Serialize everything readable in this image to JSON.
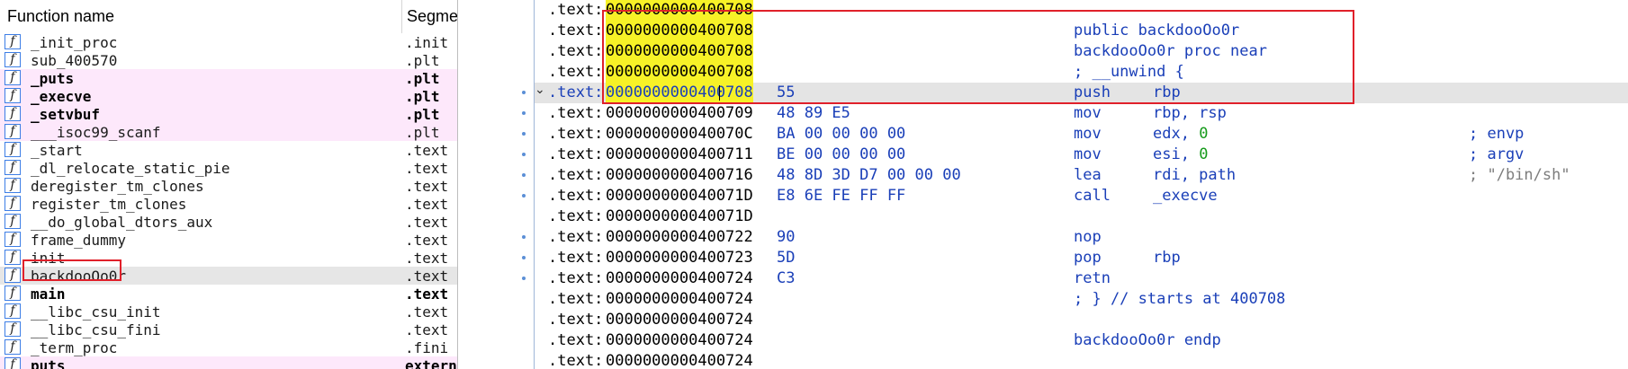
{
  "functions_pane": {
    "header": {
      "name_col": "Function name",
      "segment_col": "Segme"
    },
    "rows": [
      {
        "name": "_init_proc",
        "segment": ".init",
        "style": "normal"
      },
      {
        "name": "sub_400570",
        "segment": ".plt",
        "style": "normal"
      },
      {
        "name": "_puts",
        "segment": ".plt",
        "style": "bold-pink"
      },
      {
        "name": "_execve",
        "segment": ".plt",
        "style": "bold-pink"
      },
      {
        "name": "_setvbuf",
        "segment": ".plt",
        "style": "bold-pink"
      },
      {
        "name": "___isoc99_scanf",
        "segment": ".plt",
        "style": "pink"
      },
      {
        "name": "_start",
        "segment": ".text",
        "style": "normal"
      },
      {
        "name": "_dl_relocate_static_pie",
        "segment": ".text",
        "style": "normal"
      },
      {
        "name": "deregister_tm_clones",
        "segment": ".text",
        "style": "normal"
      },
      {
        "name": "register_tm_clones",
        "segment": ".text",
        "style": "normal"
      },
      {
        "name": "__do_global_dtors_aux",
        "segment": ".text",
        "style": "normal"
      },
      {
        "name": "frame_dummy",
        "segment": ".text",
        "style": "normal"
      },
      {
        "name": "init",
        "segment": ".text",
        "style": "normal"
      },
      {
        "name": "backdooOo0r",
        "segment": ".text",
        "style": "selected"
      },
      {
        "name": "main",
        "segment": ".text",
        "style": "bold"
      },
      {
        "name": "__libc_csu_init",
        "segment": ".text",
        "style": "normal"
      },
      {
        "name": "__libc_csu_fini",
        "segment": ".text",
        "style": "normal"
      },
      {
        "name": "_term_proc",
        "segment": ".fini",
        "style": "normal"
      },
      {
        "name": "puts",
        "segment": "extern",
        "style": "bold-pink"
      }
    ],
    "icon_glyph": "f"
  },
  "disassembly": {
    "lines": [
      {
        "seg": ".text:",
        "addr": "0000000000400708",
        "hl": true,
        "bytes": "",
        "mn": "",
        "op": "",
        "cmt": "",
        "cmt_str": false
      },
      {
        "seg": ".text:",
        "addr": "0000000000400708",
        "hl": true,
        "bytes": "",
        "mn": "public backdooOo0r",
        "op": "",
        "cmt": "",
        "cmt_str": false
      },
      {
        "seg": ".text:",
        "addr": "0000000000400708",
        "hl": true,
        "bytes": "",
        "mn": "backdooOo0r proc near",
        "op": "",
        "cmt": "",
        "cmt_str": false
      },
      {
        "seg": ".text:",
        "addr": "0000000000400708",
        "hl": true,
        "bytes": "",
        "mn": "; __unwind {",
        "op": "",
        "cmt": "",
        "cmt_str": false
      },
      {
        "seg": ".text:",
        "addr": "0000000000400708",
        "hl": true,
        "cur": true,
        "bytes": "55",
        "mn": "push",
        "op": "rbp",
        "cmt": "",
        "cmt_str": false
      },
      {
        "seg": ".text:",
        "addr": "0000000000400709",
        "hl": false,
        "bytes": "48 89 E5",
        "mn": "mov",
        "op": "rbp, rsp",
        "cmt": "",
        "cmt_str": false
      },
      {
        "seg": ".text:",
        "addr": "000000000040070C",
        "hl": false,
        "bytes": "BA 00 00 00 00",
        "mn": "mov",
        "op": "edx, ",
        "num": "0",
        "cmt": "; envp",
        "cmt_str": false
      },
      {
        "seg": ".text:",
        "addr": "0000000000400711",
        "hl": false,
        "bytes": "BE 00 00 00 00",
        "mn": "mov",
        "op": "esi, ",
        "num": "0",
        "cmt": "; argv",
        "cmt_str": false
      },
      {
        "seg": ".text:",
        "addr": "0000000000400716",
        "hl": false,
        "bytes": "48 8D 3D D7 00 00 00",
        "mn": "lea",
        "op": "rdi, path",
        "cmt": "; \"/bin/sh\"",
        "cmt_str": true
      },
      {
        "seg": ".text:",
        "addr": "000000000040071D",
        "hl": false,
        "bytes": "E8 6E FE FF FF",
        "mn": "call",
        "op": "_execve",
        "cmt": "",
        "cmt_str": false
      },
      {
        "seg": ".text:",
        "addr": "000000000040071D",
        "hl": false,
        "bytes": "",
        "mn": "",
        "op": "",
        "cmt": "",
        "cmt_str": false
      },
      {
        "seg": ".text:",
        "addr": "0000000000400722",
        "hl": false,
        "bytes": "90",
        "mn": "nop",
        "op": "",
        "cmt": "",
        "cmt_str": false
      },
      {
        "seg": ".text:",
        "addr": "0000000000400723",
        "hl": false,
        "bytes": "5D",
        "mn": "pop",
        "op": "rbp",
        "cmt": "",
        "cmt_str": false
      },
      {
        "seg": ".text:",
        "addr": "0000000000400724",
        "hl": false,
        "bytes": "C3",
        "mn": "retn",
        "op": "",
        "cmt": "",
        "cmt_str": false
      },
      {
        "seg": ".text:",
        "addr": "0000000000400724",
        "hl": false,
        "bytes": "",
        "mn": "; } // starts at 400708",
        "op": "",
        "cmt": "",
        "cmt_str": false
      },
      {
        "seg": ".text:",
        "addr": "0000000000400724",
        "hl": false,
        "bytes": "",
        "mn": "",
        "op": "",
        "cmt": "",
        "cmt_str": false
      },
      {
        "seg": ".text:",
        "addr": "0000000000400724",
        "hl": false,
        "bytes": "",
        "mn": "backdooOo0r endp",
        "op": "",
        "cmt": "",
        "cmt_str": false
      },
      {
        "seg": ".text:",
        "addr": "0000000000400724",
        "hl": false,
        "bytes": "",
        "mn": "",
        "op": "",
        "cmt": "",
        "cmt_str": false
      }
    ],
    "collapse_glyph": "⌄"
  },
  "colors": {
    "highlight_yellow": "#f7f227",
    "annotation_red": "#e0202a",
    "code_blue": "#1a3fb8",
    "number_green": "#159a1a",
    "import_pink": "#fde8fb"
  }
}
